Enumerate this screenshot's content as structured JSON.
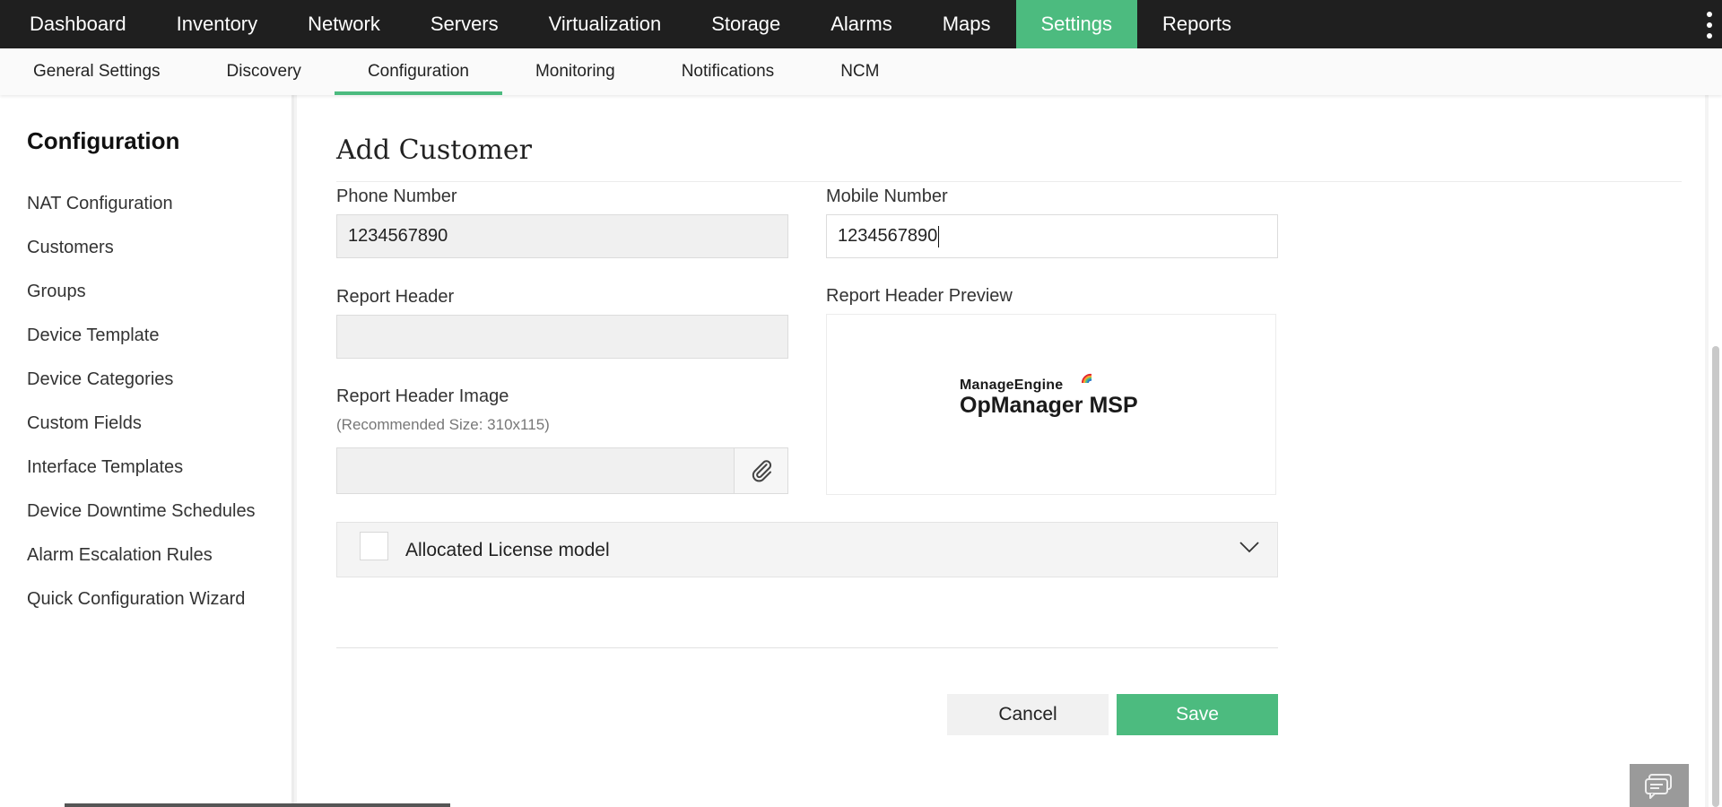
{
  "topnav": {
    "items": [
      {
        "label": "Dashboard"
      },
      {
        "label": "Inventory"
      },
      {
        "label": "Network"
      },
      {
        "label": "Servers"
      },
      {
        "label": "Virtualization"
      },
      {
        "label": "Storage"
      },
      {
        "label": "Alarms"
      },
      {
        "label": "Maps"
      },
      {
        "label": "Settings",
        "active": true
      },
      {
        "label": "Reports"
      }
    ],
    "more_icon": "kebab-vertical-icon"
  },
  "subnav": {
    "items": [
      {
        "label": "General Settings"
      },
      {
        "label": "Discovery"
      },
      {
        "label": "Configuration",
        "active": true
      },
      {
        "label": "Monitoring"
      },
      {
        "label": "Notifications"
      },
      {
        "label": "NCM"
      }
    ]
  },
  "sidebar": {
    "title": "Configuration",
    "items": [
      {
        "label": "NAT Configuration"
      },
      {
        "label": "Customers"
      },
      {
        "label": "Groups"
      },
      {
        "label": "Device Template"
      },
      {
        "label": "Device Categories"
      },
      {
        "label": "Custom Fields"
      },
      {
        "label": "Interface Templates"
      },
      {
        "label": "Device Downtime Schedules"
      },
      {
        "label": "Alarm Escalation Rules"
      },
      {
        "label": "Quick Configuration Wizard"
      }
    ]
  },
  "form": {
    "title": "Add Customer",
    "phone": {
      "label": "Phone Number",
      "value": "1234567890"
    },
    "mobile": {
      "label": "Mobile Number",
      "value": "1234567890"
    },
    "report_header": {
      "label": "Report Header",
      "value": ""
    },
    "report_header_preview": {
      "label": "Report Header Preview",
      "logo_brand": "ManageEngine",
      "logo_product": "OpManager MSP"
    },
    "report_header_image": {
      "label": "Report Header Image",
      "hint": "(Recommended Size: 310x115)",
      "value": "",
      "attach_icon": "paperclip-icon"
    },
    "license": {
      "label": "Allocated License model",
      "checked": false,
      "expanded": false
    },
    "buttons": {
      "cancel": "Cancel",
      "save": "Save"
    }
  },
  "colors": {
    "accent": "#4cbb7f",
    "topnav_bg": "#1f1f1f"
  }
}
